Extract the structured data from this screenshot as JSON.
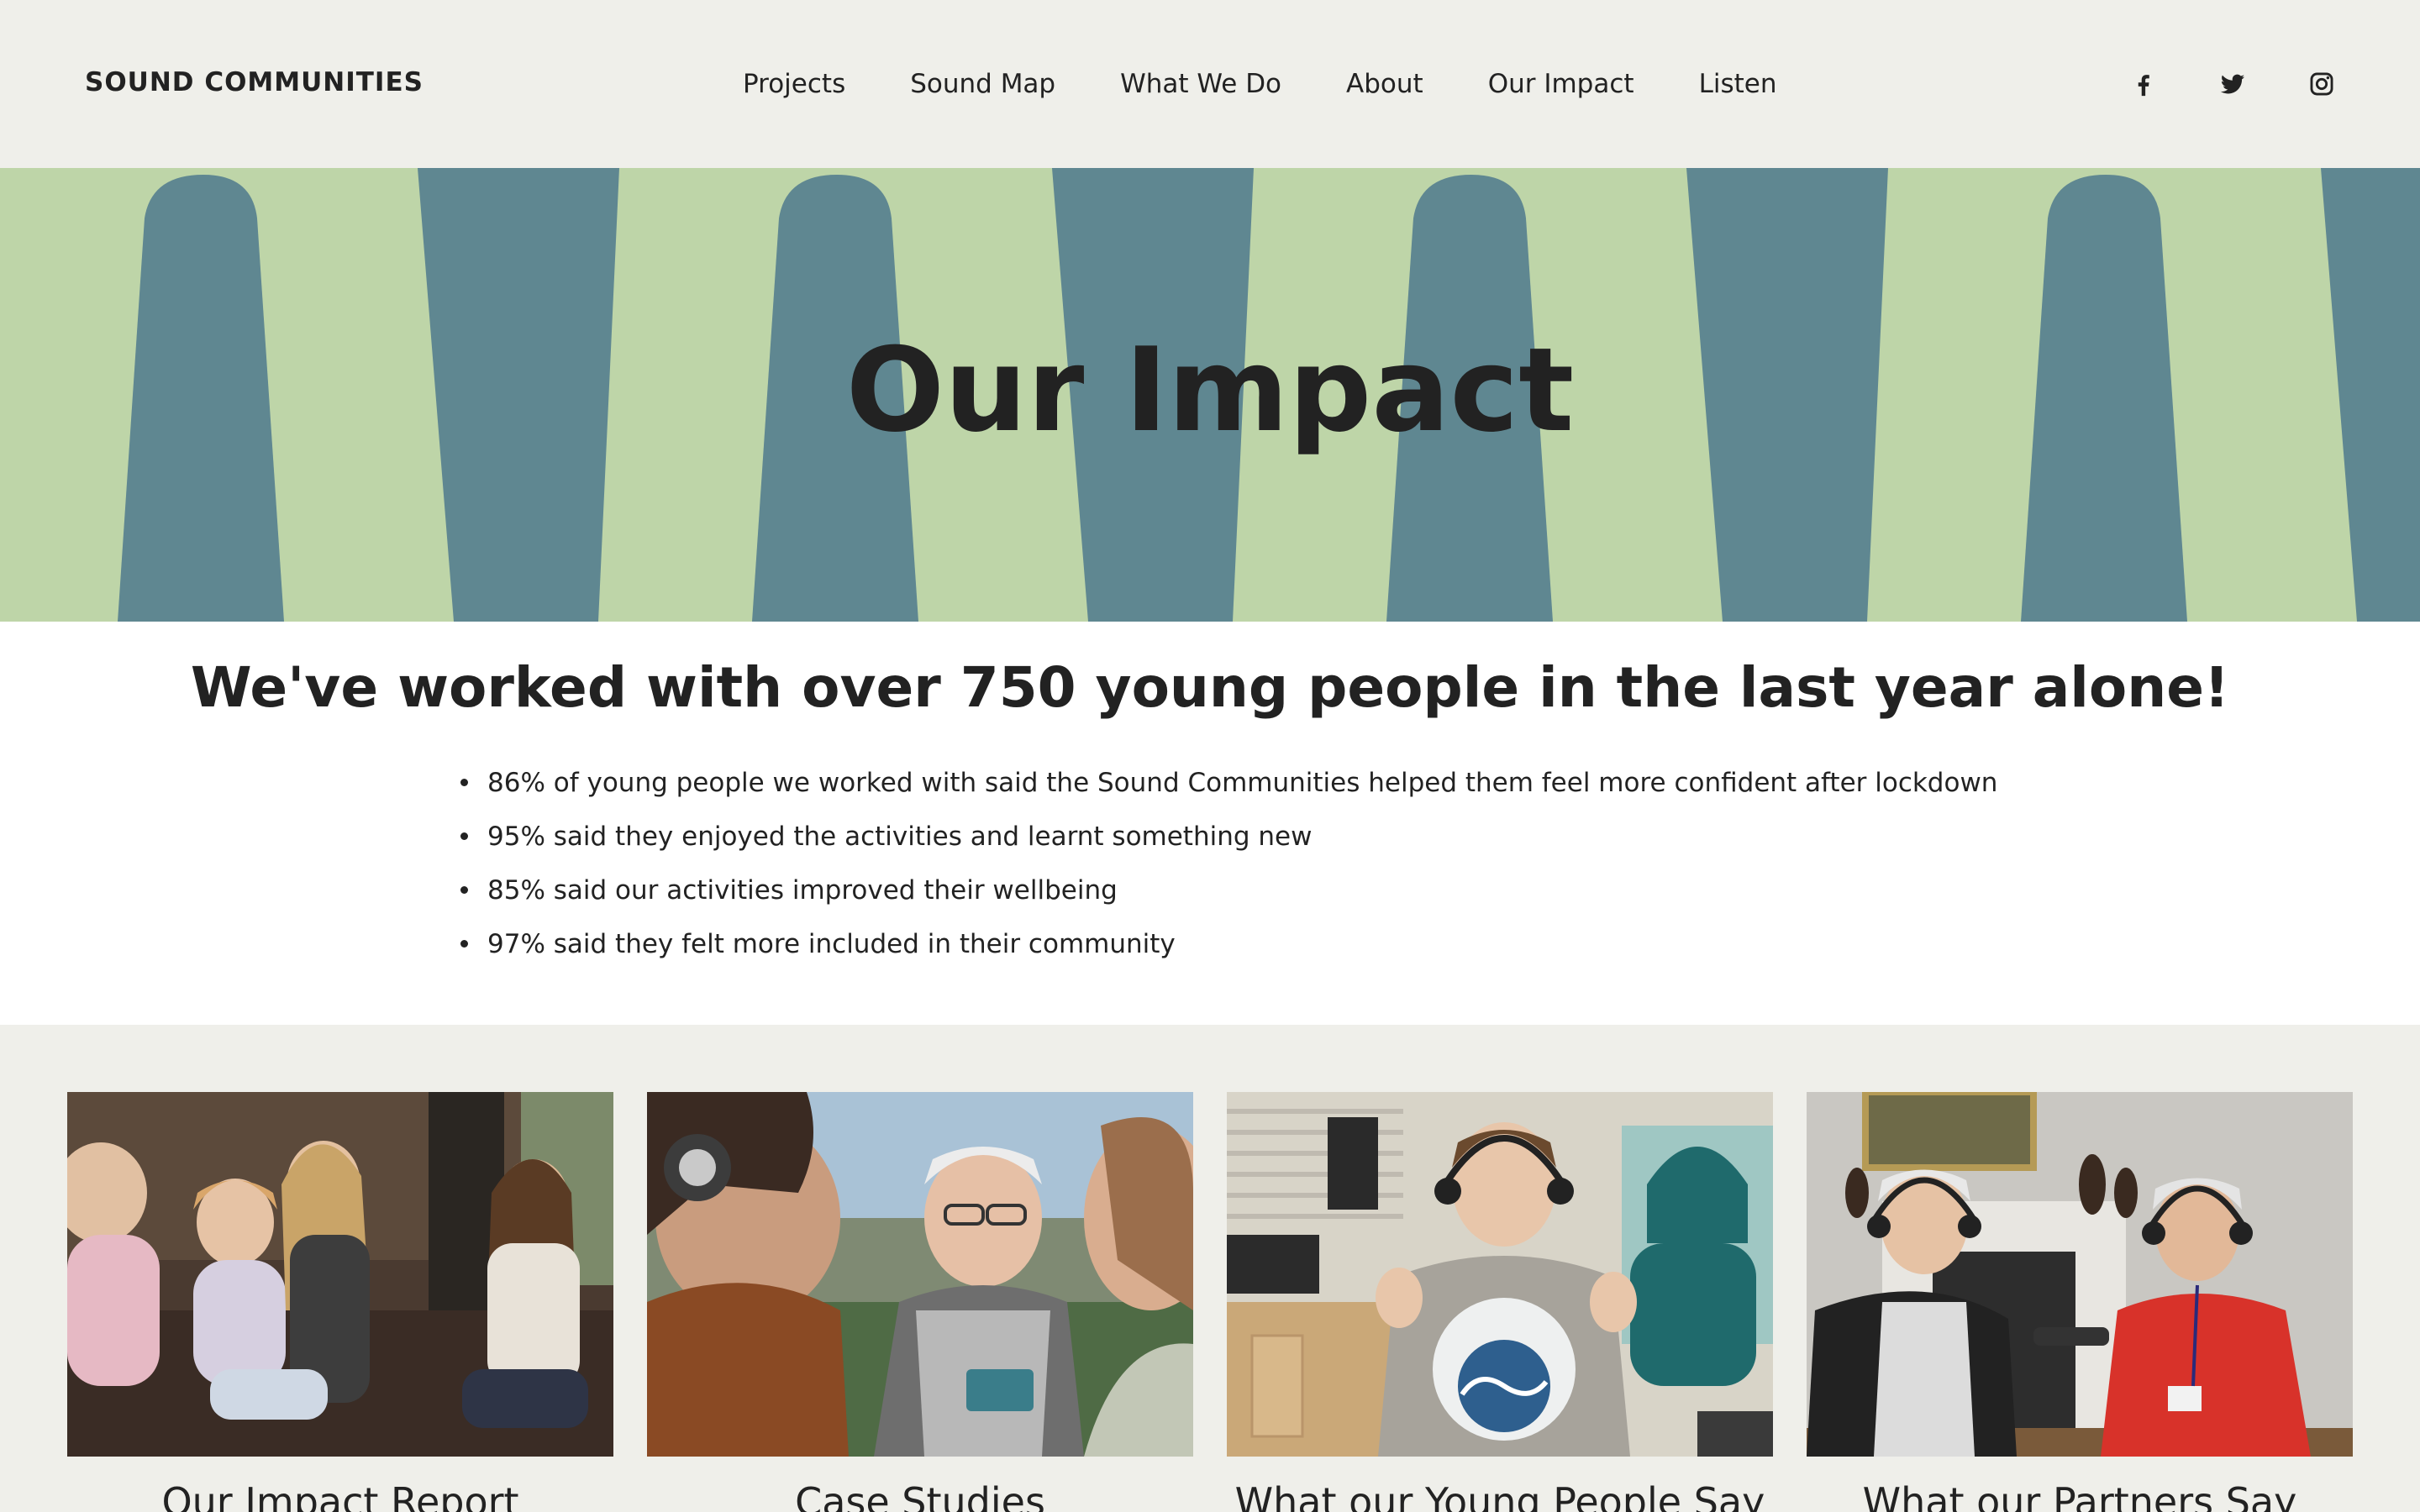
{
  "header": {
    "logo": "SOUND COMMUNITIES",
    "nav": [
      {
        "label": "Projects"
      },
      {
        "label": "Sound Map"
      },
      {
        "label": "What We Do"
      },
      {
        "label": "About"
      },
      {
        "label": "Our Impact"
      },
      {
        "label": "Listen"
      }
    ],
    "social": [
      {
        "icon": "facebook-icon"
      },
      {
        "icon": "twitter-icon"
      },
      {
        "icon": "instagram-icon"
      }
    ]
  },
  "hero": {
    "title": "Our Impact",
    "colors": {
      "background": "#bed5a8",
      "shape": "#5f8791"
    }
  },
  "stats": {
    "heading": "We've worked with over 750 young people in the last year alone!",
    "items": [
      "86% of young people we worked with said the Sound Communities helped them feel more confident after lockdown",
      "95% said they enjoyed the activities and learnt something new",
      "85% said our activities improved their wellbeing",
      "97% said they felt more included in their community"
    ]
  },
  "cards": [
    {
      "title": "Our Impact Report"
    },
    {
      "title": "Case Studies"
    },
    {
      "title": "What our Young People Say"
    },
    {
      "title": "What our Partners Say"
    }
  ]
}
